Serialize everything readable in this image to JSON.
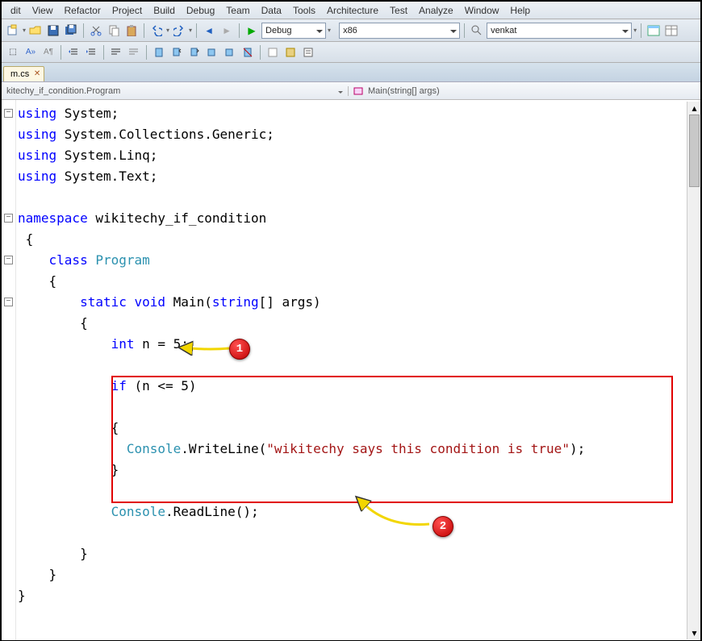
{
  "menu": [
    "dit",
    "View",
    "Refactor",
    "Project",
    "Build",
    "Debug",
    "Team",
    "Data",
    "Tools",
    "Architecture",
    "Test",
    "Analyze",
    "Window",
    "Help"
  ],
  "combos": {
    "config": "Debug",
    "platform": "x86",
    "find": "venkat"
  },
  "tab": {
    "label": "m.cs"
  },
  "nav": {
    "left": "kitechy_if_condition.Program",
    "right": "Main(string[] args)"
  },
  "code": {
    "lines": [
      {
        "collapse": "-",
        "segs": [
          [
            "kw",
            "using"
          ],
          [
            " System;"
          ]
        ]
      },
      {
        "segs": [
          [
            "kw",
            "using"
          ],
          [
            " System.Collections.Generic;"
          ]
        ]
      },
      {
        "segs": [
          [
            "kw",
            "using"
          ],
          [
            " System.Linq;"
          ]
        ]
      },
      {
        "segs": [
          [
            "kw",
            "using"
          ],
          [
            " System.Text;"
          ]
        ]
      },
      {
        "segs": [
          [
            "",
            " "
          ]
        ]
      },
      {
        "collapse": "-",
        "segs": [
          [
            "kw",
            "namespace"
          ],
          [
            " wikitechy_if_condition"
          ]
        ]
      },
      {
        "segs": [
          [
            " {"
          ]
        ]
      },
      {
        "collapse": "-",
        "segs": [
          [
            "",
            "    "
          ],
          [
            "kw",
            "class"
          ],
          [
            " "
          ],
          [
            "typ",
            "Program"
          ]
        ]
      },
      {
        "segs": [
          [
            "    {"
          ]
        ]
      },
      {
        "collapse": "-",
        "segs": [
          [
            "",
            "        "
          ],
          [
            "kw",
            "static"
          ],
          [
            " "
          ],
          [
            "kw",
            "void"
          ],
          [
            " Main("
          ],
          [
            "kw",
            "string"
          ],
          [
            "[] args)"
          ]
        ]
      },
      {
        "segs": [
          [
            "        {"
          ]
        ]
      },
      {
        "segs": [
          [
            "",
            "            "
          ],
          [
            "kw",
            "int"
          ],
          [
            " n = 5;"
          ]
        ]
      },
      {
        "segs": [
          [
            "",
            " "
          ]
        ]
      },
      {
        "segs": [
          [
            "",
            "            "
          ],
          [
            "kw",
            "if"
          ],
          [
            " (n <= 5)"
          ]
        ]
      },
      {
        "segs": [
          [
            "",
            " "
          ]
        ]
      },
      {
        "segs": [
          [
            "            {"
          ]
        ]
      },
      {
        "segs": [
          [
            "",
            "              "
          ],
          [
            "typ",
            "Console"
          ],
          [
            ".WriteLine("
          ],
          [
            "str",
            "\"wikitechy says this condition is true\""
          ],
          [
            ");"
          ]
        ]
      },
      {
        "segs": [
          [
            "            }"
          ]
        ]
      },
      {
        "segs": [
          [
            "",
            " "
          ]
        ]
      },
      {
        "segs": [
          [
            "",
            "            "
          ],
          [
            "typ",
            "Console"
          ],
          [
            ".ReadLine();"
          ]
        ]
      },
      {
        "segs": [
          [
            "",
            " "
          ]
        ]
      },
      {
        "segs": [
          [
            "        }"
          ]
        ]
      },
      {
        "segs": [
          [
            "    }"
          ]
        ]
      },
      {
        "segs": [
          [
            "}"
          ]
        ]
      }
    ]
  },
  "annotations": {
    "badge1": "1",
    "badge2": "2"
  }
}
